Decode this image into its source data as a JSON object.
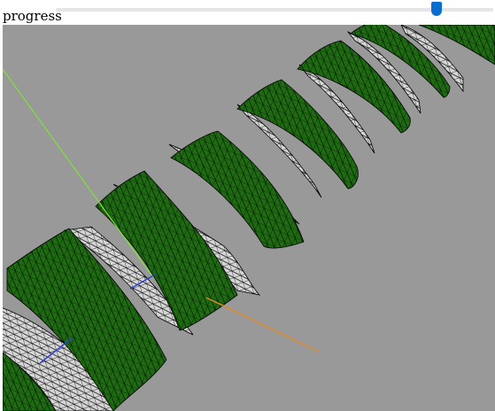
{
  "controls": {
    "progress_label": "progress",
    "progress_value": 0.87
  },
  "scene": {
    "background_color": "#999999",
    "ribbon_outer_color": "#1e6b12",
    "ribbon_inner_color": "#d0d0d0",
    "mesh_color": "#000000",
    "axis_colors": {
      "green": "#7fe03a",
      "blue": "#2f3fd8",
      "orange": "#e08a2e"
    }
  }
}
